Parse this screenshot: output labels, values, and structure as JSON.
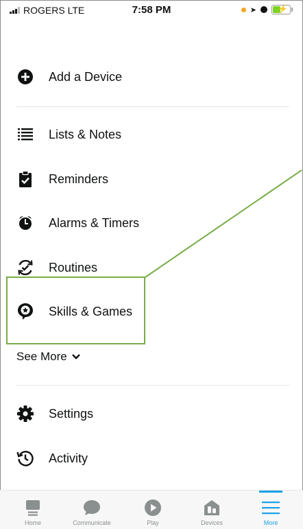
{
  "status_bar": {
    "carrier": "ROGERS  LTE",
    "time": "7:58 PM",
    "battery_percent": 45
  },
  "menu": {
    "add_device": "Add a Device",
    "lists_notes": "Lists & Notes",
    "reminders": "Reminders",
    "alarms_timers": "Alarms & Timers",
    "routines": "Routines",
    "skills_games": "Skills & Games",
    "see_more": "See More",
    "settings": "Settings",
    "activity": "Activity"
  },
  "tabs": {
    "home": "Home",
    "communicate": "Communicate",
    "play": "Play",
    "devices": "Devices",
    "more": "More"
  },
  "colors": {
    "accent": "#1aa1e6",
    "highlight": "#77ac47",
    "tab_icon": "#8a8f8f"
  }
}
